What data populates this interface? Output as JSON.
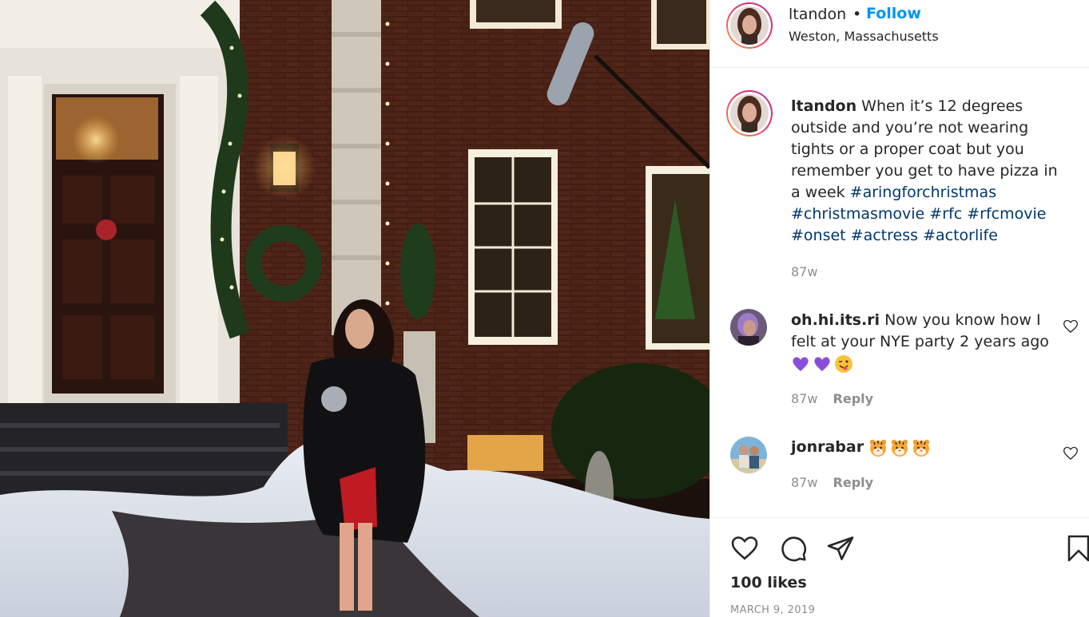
{
  "post": {
    "photo_icon": "photo-of-woman-in-front-of-decorated-brick-house"
  },
  "header": {
    "username": "ltandon",
    "separator": "•",
    "follow_label": "Follow",
    "location": "Weston, Massachusetts"
  },
  "caption": {
    "username": "ltandon",
    "text": "When it’s 12 degrees outside and you’re not wearing tights or a proper coat but you remember you get to have pizza in a week",
    "hashtags": [
      "#aringforchristmas",
      "#christmasmovie",
      "#rfc",
      "#rfcmovie",
      "#onset",
      "#actress",
      "#actorlife"
    ],
    "time": "87w"
  },
  "comments": [
    {
      "username": "oh.hi.its.ri",
      "text": "Now you know how I felt at your NYE party 2 years ago",
      "emojis": [
        "purple-heart-icon",
        "purple-heart-icon",
        "winking-face-tongue-icon"
      ],
      "time": "87w",
      "reply_label": "Reply"
    },
    {
      "username": "jonrabar",
      "text": "",
      "emojis": [
        "tiger-face-icon",
        "tiger-face-icon",
        "tiger-face-icon"
      ],
      "time": "87w",
      "reply_label": "Reply"
    }
  ],
  "actions": {
    "like_icon": "heart-icon",
    "comment_icon": "comment-icon",
    "share_icon": "share-icon",
    "save_icon": "bookmark-icon",
    "likes": "100 likes",
    "date": "MARCH 9, 2019"
  },
  "colors": {
    "follow": "#0095f6",
    "hashtag": "#00376b",
    "muted": "#8e8e8e"
  }
}
